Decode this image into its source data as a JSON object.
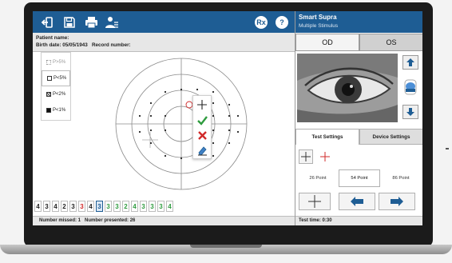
{
  "app": {
    "title": "Smart Supra",
    "subtitle": "Multiple Stimulus"
  },
  "toolbar": {
    "rx_label": "Rx",
    "help_label": "?"
  },
  "patient": {
    "name_label": "Patient name:",
    "birth_label": "Birth date: 05/05/1943",
    "record_label": "Record number:"
  },
  "legend": [
    {
      "label": "P>5%",
      "icon": "dotted-square"
    },
    {
      "label": "P<5%",
      "icon": "light-square"
    },
    {
      "label": "P<2%",
      "icon": "dark-square"
    },
    {
      "label": "P<1%",
      "icon": "black-square"
    }
  ],
  "digits": [
    {
      "value": "4",
      "color": "#222222"
    },
    {
      "value": "3",
      "color": "#222222"
    },
    {
      "value": "4",
      "color": "#222222"
    },
    {
      "value": "2",
      "color": "#222222"
    },
    {
      "value": "3",
      "color": "#222222"
    },
    {
      "value": "3",
      "color": "#d12a2a"
    },
    {
      "value": "4",
      "color": "#222222"
    },
    {
      "value": "3",
      "color": "#1e5d94",
      "selected": true
    },
    {
      "value": "3",
      "color": "#2e9b3e"
    },
    {
      "value": "3",
      "color": "#2e9b3e"
    },
    {
      "value": "2",
      "color": "#2e9b3e"
    },
    {
      "value": "4",
      "color": "#2e9b3e"
    },
    {
      "value": "3",
      "color": "#2e9b3e"
    },
    {
      "value": "3",
      "color": "#2e9b3e"
    },
    {
      "value": "3",
      "color": "#2e9b3e"
    },
    {
      "value": "4",
      "color": "#2e9b3e"
    }
  ],
  "status_left": "Number missed: 1   Number presented: 26",
  "eyes": {
    "od": "OD",
    "os": "OS",
    "selected": "OS"
  },
  "tabs": {
    "test_settings": "Test Settings",
    "device_settings": "Device Settings",
    "selected": "Test Settings"
  },
  "points": {
    "p26": "26 Point",
    "p54": "54 Point",
    "p86": "86 Point",
    "selected": "54 Point"
  },
  "status_right": "Test time: 0:30",
  "colors": {
    "brand": "#1e5d94",
    "ok": "#2e9b3e",
    "cancel": "#d12a2a"
  },
  "icons": [
    "exit-icon",
    "save-icon",
    "print-icon",
    "patient-icon",
    "rx-icon",
    "help-icon",
    "arrow-up-icon",
    "eye-icon",
    "arrow-down-icon",
    "crosshair-icon",
    "check-icon",
    "close-icon",
    "eraser-icon",
    "arrow-left-icon",
    "arrow-right-icon"
  ]
}
